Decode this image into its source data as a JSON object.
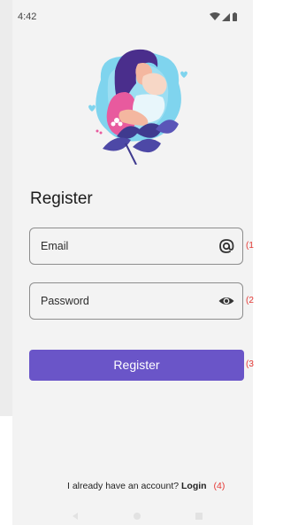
{
  "status_bar": {
    "time": "4:42",
    "icons": [
      "wifi-icon",
      "signal-icon",
      "battery-icon"
    ]
  },
  "illustration": {
    "name": "mother-and-baby-illustration",
    "colors": {
      "hair": "#4a2e8c",
      "shirt": "#e85a9e",
      "backdrop_blue": "#7fd4ee",
      "leaves": "#3f3a8f",
      "skin": "#f4b7a0"
    }
  },
  "page": {
    "title": "Register"
  },
  "form": {
    "email": {
      "placeholder": "Email",
      "icon": "at-sign-icon",
      "marker": "(1"
    },
    "password": {
      "placeholder": "Password",
      "icon": "eye-icon",
      "marker": "(2"
    },
    "submit": {
      "label": "Register",
      "marker": "(3"
    }
  },
  "footer": {
    "prompt": "I already have an account?",
    "login_label": "Login",
    "marker": "(4)"
  },
  "colors": {
    "accent": "#6a55c8",
    "marker": "#e53935",
    "background": "#f3f3f3"
  }
}
